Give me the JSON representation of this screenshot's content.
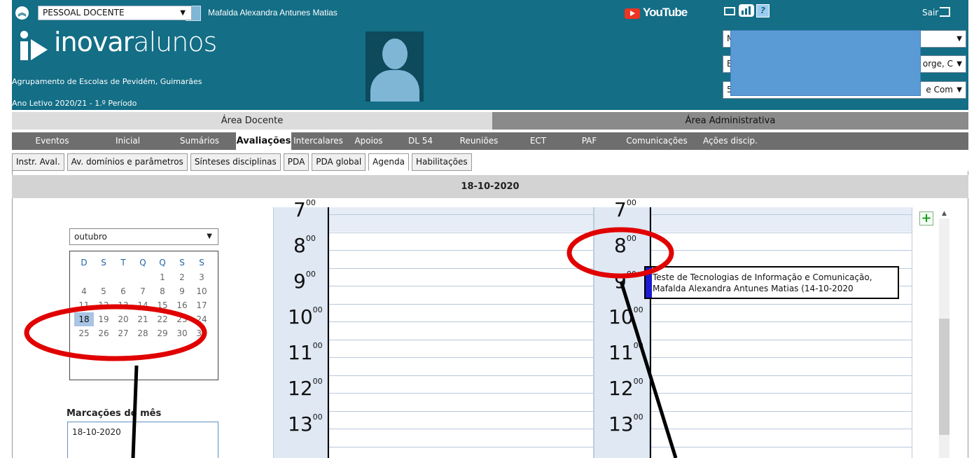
{
  "topbar": {
    "role_select": "PESSOAL DOCENTE",
    "user_name": "Mafalda Alexandra Antunes Matias",
    "youtube_label": "YouTube",
    "logout_label": "Sair"
  },
  "brand": {
    "logo_inovar": "inovar",
    "logo_alunos": "alunos",
    "school": "Agrupamento de Escolas de Pevidém, Guimarães",
    "period": "Ano Letivo 2020/21 - 1.º Período"
  },
  "right_selects": [
    {
      "value": "M"
    },
    {
      "value": "E",
      "tail": "orge, C"
    },
    {
      "value": "5",
      "tail": "e Com"
    }
  ],
  "areas": {
    "docente": "Área Docente",
    "administrativa": "Área Administrativa"
  },
  "menu": [
    "Eventos",
    "Inicial",
    "Sumários",
    "Avaliações",
    "Intercalares",
    "Apoios",
    "DL 54",
    "Reuniões",
    "ECT",
    "PAF",
    "Comunicações",
    "Ações discip."
  ],
  "menu_active": 3,
  "subtabs": [
    "Instr. Aval.",
    "Av. domínios e parâmetros",
    "Sínteses disciplinas",
    "PDA",
    "PDA global",
    "Agenda",
    "Habilitações"
  ],
  "subtab_active": 5,
  "date_band": "18-10-2020",
  "calendar": {
    "month": "outubro",
    "weekdays": [
      "D",
      "S",
      "T",
      "Q",
      "Q",
      "S",
      "S"
    ],
    "weeks": [
      [
        "",
        "",
        "",
        "",
        "1",
        "2",
        "3"
      ],
      [
        "4",
        "5",
        "6",
        "7",
        "8",
        "9",
        "10"
      ],
      [
        "11",
        "12",
        "13",
        "14",
        "15",
        "16",
        "17"
      ],
      [
        "18",
        "19",
        "20",
        "21",
        "22",
        "23",
        "24"
      ],
      [
        "25",
        "26",
        "27",
        "28",
        "29",
        "30",
        "31"
      ]
    ],
    "selected": "18"
  },
  "marcacoes": {
    "title": "Marcações do mês",
    "items": [
      "18-10-2020"
    ]
  },
  "hours": [
    "7",
    "8",
    "9",
    "10",
    "11",
    "12",
    "13"
  ],
  "hour_sup": "00",
  "event": {
    "line1": "Teste de Tecnologias de Informação e Comunicação,",
    "line2": "Mafalda Alexandra Antunes Matias (14-10-2020"
  },
  "colors": {
    "header": "#136e86",
    "event_bar": "#1a1ad0",
    "annotation": "#e00000",
    "selected_day": "#a9c4e4"
  }
}
